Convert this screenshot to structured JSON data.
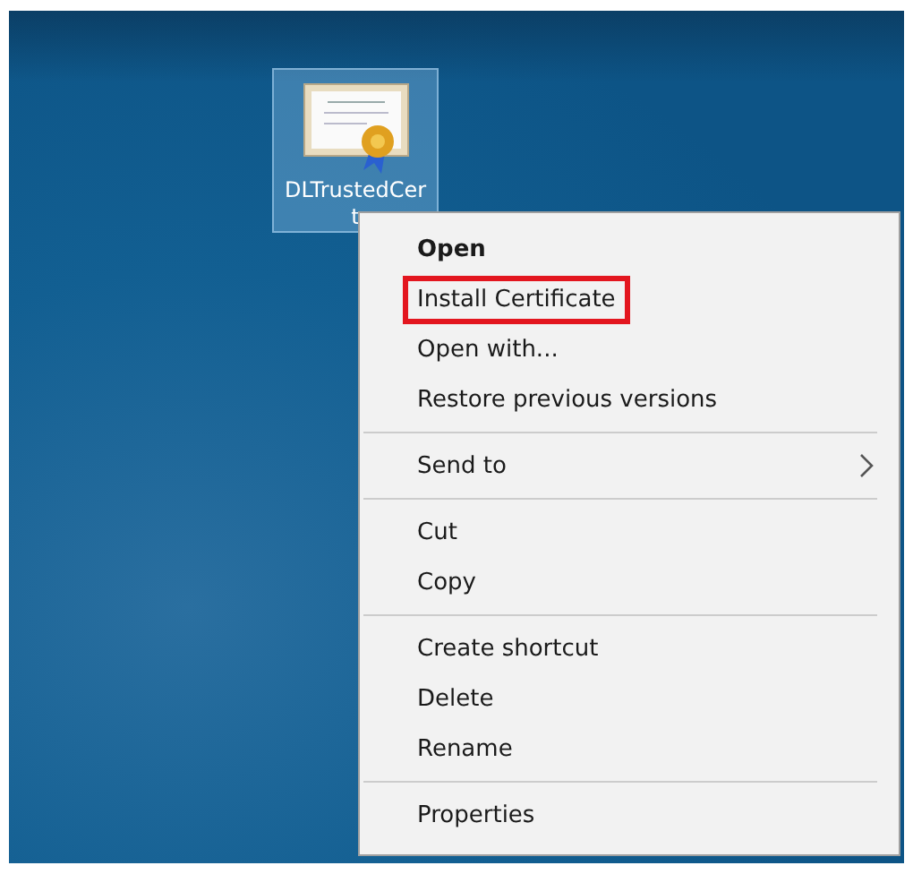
{
  "desktop_icon": {
    "label_lines": [
      "DLTrustedCer",
      "t"
    ],
    "selected": true
  },
  "context_menu": {
    "groups": [
      [
        {
          "label": "Open",
          "kind": "default",
          "highlighted": false
        },
        {
          "label": "Install Certificate",
          "kind": "item",
          "highlighted": true
        },
        {
          "label": "Open with...",
          "kind": "item",
          "highlighted": false
        },
        {
          "label": "Restore previous versions",
          "kind": "item",
          "highlighted": false
        }
      ],
      [
        {
          "label": "Send to",
          "kind": "submenu",
          "highlighted": false
        }
      ],
      [
        {
          "label": "Cut",
          "kind": "item",
          "highlighted": false
        },
        {
          "label": "Copy",
          "kind": "item",
          "highlighted": false
        }
      ],
      [
        {
          "label": "Create shortcut",
          "kind": "item",
          "highlighted": false
        },
        {
          "label": "Delete",
          "kind": "item",
          "highlighted": false
        },
        {
          "label": "Rename",
          "kind": "item",
          "highlighted": false
        }
      ],
      [
        {
          "label": "Properties",
          "kind": "item",
          "highlighted": false
        }
      ]
    ]
  }
}
